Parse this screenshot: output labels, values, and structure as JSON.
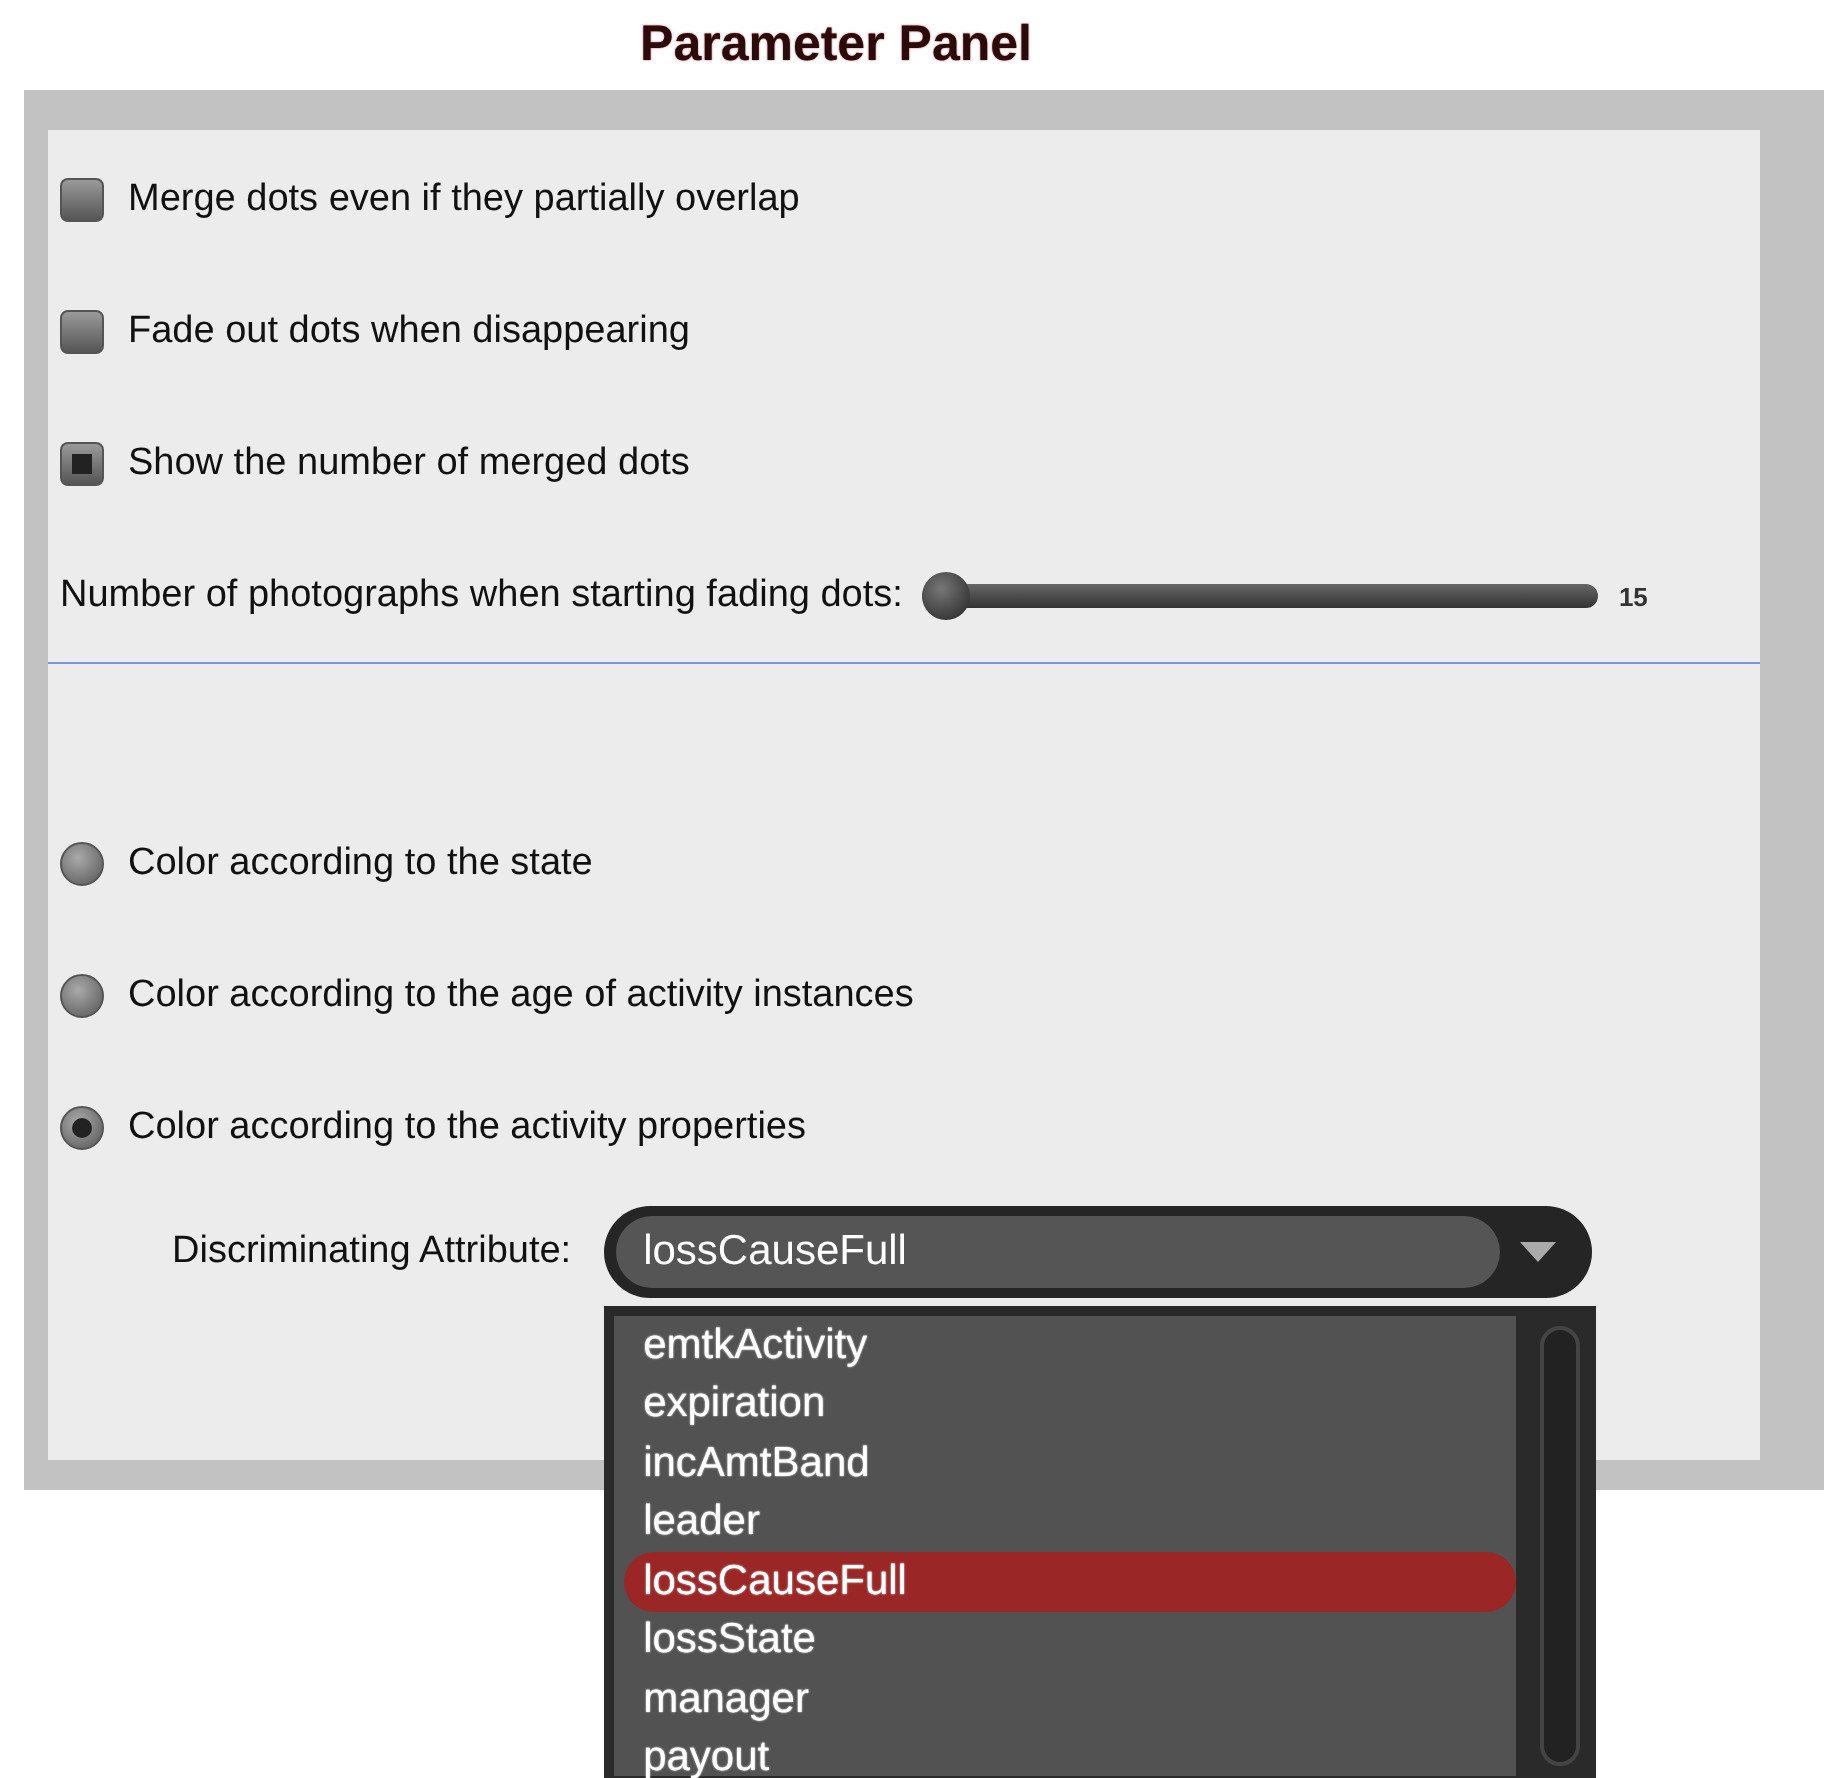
{
  "title": "Parameter Panel",
  "checkboxes": [
    {
      "label": "Merge dots even if they partially overlap",
      "checked": false
    },
    {
      "label": "Fade out dots when disappearing",
      "checked": false
    },
    {
      "label": "Show the number of merged dots",
      "checked": true
    }
  ],
  "slider": {
    "label": "Number of photographs when starting fading dots:",
    "level": 0,
    "reading": "15"
  },
  "color_modes": [
    {
      "label": "Color according to the state",
      "selected": false
    },
    {
      "label": "Color according to the age of activity instances",
      "selected": false
    },
    {
      "label": "Color according to the activity properties",
      "selected": true
    }
  ],
  "attribute": {
    "label": "Discriminating Attribute:",
    "value": "lossCauseFull",
    "expanded": true,
    "options": [
      {
        "label": "emtkActivity",
        "selected": false
      },
      {
        "label": "expiration",
        "selected": false
      },
      {
        "label": "incAmtBand",
        "selected": false
      },
      {
        "label": "leader",
        "selected": false
      },
      {
        "label": "lossCauseFull",
        "selected": true
      },
      {
        "label": "lossState",
        "selected": false
      },
      {
        "label": "manager",
        "selected": false
      },
      {
        "label": "payout",
        "selected": false
      }
    ]
  }
}
